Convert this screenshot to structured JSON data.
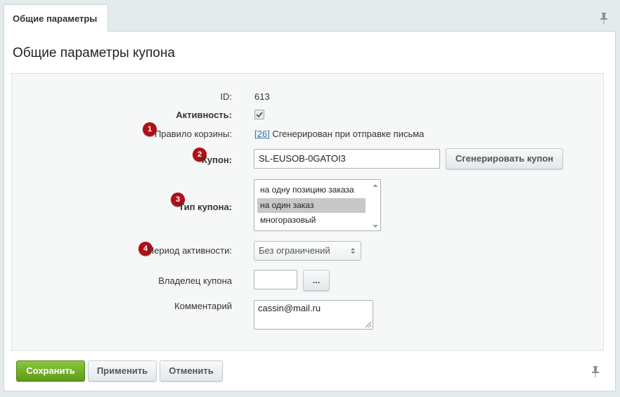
{
  "tab": {
    "label": "Общие параметры"
  },
  "panel": {
    "title": "Общие параметры купона"
  },
  "form": {
    "id_label": "ID:",
    "id_value": "613",
    "active_label": "Активность:",
    "active_checked": true,
    "rule_label": "Правило корзины:",
    "rule_link": "[26]",
    "rule_text": "Сгенерирован при отправке письма",
    "coupon_label": "Купон:",
    "coupon_value": "SL-EUSOB-0GATOI3",
    "generate_label": "Сгенерировать купон",
    "type_label": "Тип купона:",
    "type_options": [
      "на одну позицию заказа",
      "на один заказ",
      "многоразовый"
    ],
    "type_selected": "на один заказ",
    "period_label": "Период активности:",
    "period_value": "Без ограничений",
    "owner_label": "Владелец купона",
    "owner_value": "",
    "owner_browse": "...",
    "comment_label": "Комментарий",
    "comment_value": "cassin@mail.ru"
  },
  "badges": [
    "1",
    "2",
    "3",
    "4"
  ],
  "footer": {
    "save_label": "Сохранить",
    "apply_label": "Применить",
    "cancel_label": "Отменить"
  },
  "colors": {
    "badge": "#b10f15",
    "save": "#6fae23",
    "link": "#2b6fb4"
  }
}
